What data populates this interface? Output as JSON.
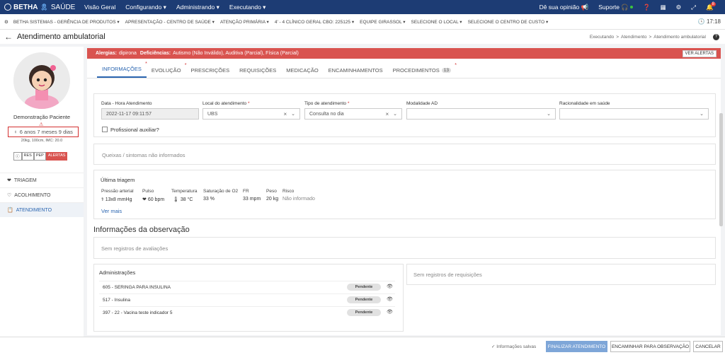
{
  "topnav": {
    "logo_brand": "BETHA",
    "logo_product": "SAÚDE",
    "items": [
      "Visão Geral",
      "Configurando ▾",
      "Administrando ▾",
      "Executando ▾"
    ],
    "feedback": "Dê sua opinião",
    "support": "Suporte",
    "notif_count": "8"
  },
  "context": {
    "items": [
      "BETHA SISTEMAS - GERÊNCIA DE PRODUTOS ▾",
      "APRESENTAÇÃO - CENTRO DE SAÚDE ▾",
      "ATENÇÃO PRIMÁRIA ▾",
      "4' - 4 CLÍNICO GERAL CBO: 225125 ▾",
      "EQUIPE GIRASSOL ▾",
      "SELECIONE O LOCAL ▾",
      "SELECIONE O CENTRO DE CUSTO ▾"
    ],
    "clock": "17:18"
  },
  "titlebar": {
    "title": "Atendimento ambulatorial",
    "breadcrumb": [
      "Executando",
      ">",
      "Atendimento",
      ">",
      "Atendimento ambulatorial"
    ]
  },
  "patient": {
    "name": "Demonstração Paciente",
    "age": "6 anos 7 meses 9 dias",
    "anthro": "20kg, 100cm, IMC: 20.0",
    "tags": [
      "ⓘ",
      "RES",
      "PEP",
      "ALERTAS"
    ]
  },
  "leftnav": {
    "items": [
      "TRIAGEM",
      "ACOLHIMENTO",
      "ATENDIMENTO"
    ]
  },
  "alerts": {
    "alergias_label": "Alergias:",
    "alergias": "dipirona",
    "deficiencias_label": "Deficiências:",
    "deficiencias": "Autismo (Não Inválido), Auditiva (Parcial), Física (Parcial)",
    "button": "VER ALERTAS"
  },
  "tabs": {
    "items": [
      "INFORMAÇÕES",
      "EVOLUÇÃO",
      "PRESCRIÇÕES",
      "REQUISIÇÕES",
      "MEDICAÇÃO",
      "ENCAMINHAMENTOS",
      "PROCEDIMENTOS"
    ],
    "procedimentos_count": "13"
  },
  "form": {
    "data_hora_label": "Data - Hora Atendimento",
    "data_hora_value": "2022-11-17 09:11:57",
    "local_label": "Local do atendimento",
    "local_value": "UBS",
    "tipo_label": "Tipo de atendimento",
    "tipo_value": "Consulta no dia",
    "modalidade_label": "Modalidade AD",
    "racionalidade_label": "Racionalidade em saúde",
    "profissional_auxiliar": "Profissional auxiliar?"
  },
  "queixas": "Queixas / sintomas não informados",
  "triagem": {
    "title": "Última triagem",
    "labels": [
      "Pressão arterial",
      "Pulso",
      "Temperatura",
      "Saturação de O2",
      "FR",
      "Peso",
      "Risco"
    ],
    "values": [
      "13x8 mmHg",
      "60 bpm",
      "38 °C",
      "33 %",
      "33 mpm",
      "20 kg",
      "Não informado"
    ],
    "ver_mais": "Ver mais"
  },
  "observacao": {
    "title": "Informações da observação",
    "avaliacoes": "Sem registros de avaliações",
    "administracoes_title": "Administrações",
    "requisicoes": "Sem registros de requisições",
    "rows": [
      {
        "name": "605 - SERINGA PARA INSULINA",
        "status": "Pendente"
      },
      {
        "name": "517 - Insulina",
        "status": "Pendente"
      },
      {
        "name": "397 - 22 - Vacina teste indicador 5",
        "status": "Pendente"
      }
    ]
  },
  "footer": {
    "saved": "Informações salvas",
    "finalizar": "FINALIZAR ATENDIMENTO",
    "encaminhar": "ENCAMINHAR PARA OBSERVAÇÃO",
    "cancelar": "CANCELAR"
  },
  "colors": {
    "nav_bg": "#1d3c74",
    "alert_red": "#d9534f",
    "accent_blue": "#2a65b0",
    "primary_btn": "#7ea6d8"
  }
}
